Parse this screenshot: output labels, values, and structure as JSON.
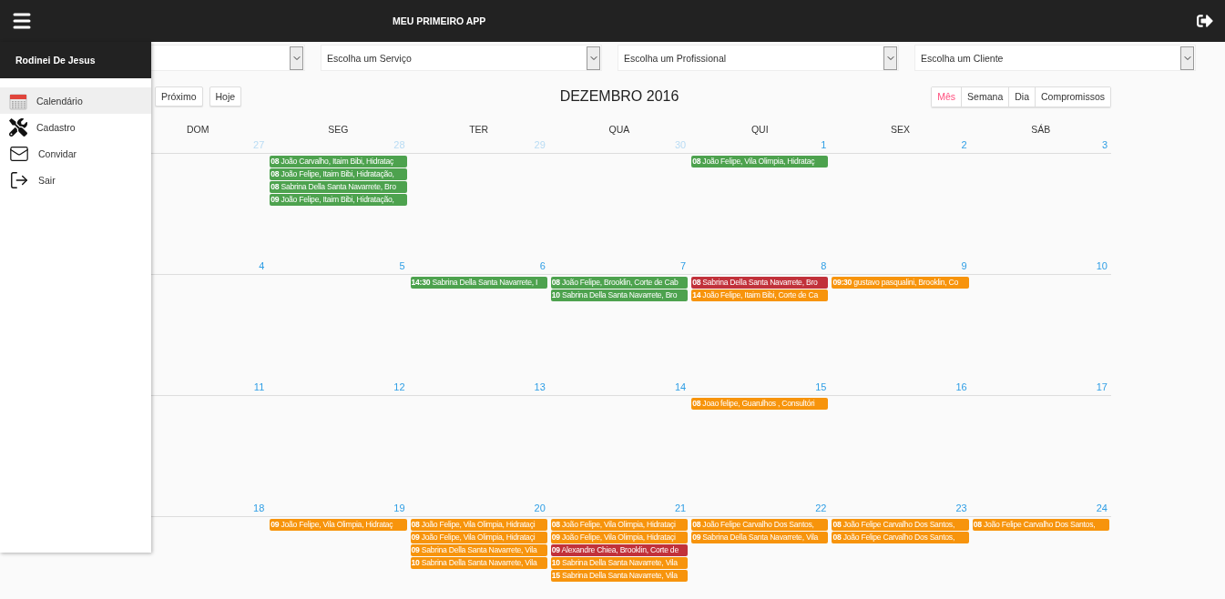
{
  "topbar": {
    "title": "MEU PRIMEIRO APP"
  },
  "drawer": {
    "user": "Rodinei De Jesus",
    "items": [
      {
        "kind": "calendar",
        "label": "Calendário",
        "selected": true
      },
      {
        "kind": "tools",
        "label": "Cadastro",
        "selected": false
      },
      {
        "kind": "mail",
        "label": "Convidar",
        "selected": false
      },
      {
        "kind": "exit",
        "label": "Sair",
        "selected": false
      }
    ]
  },
  "filters": [
    {
      "value": "Escolha um Serviço"
    },
    {
      "value": "Escolha um Profissional"
    },
    {
      "value": "Escolha um Cliente"
    }
  ],
  "nav_buttons": [
    "Próximo",
    "Hoje"
  ],
  "title": "DEZEMBRO 2016",
  "views": [
    {
      "label": "Mês",
      "selected": true
    },
    {
      "label": "Semana",
      "selected": false
    },
    {
      "label": "Dia",
      "selected": false
    },
    {
      "label": "Compromissos",
      "selected": false
    }
  ],
  "weekdays": [
    "DOM",
    "SEG",
    "TER",
    "QUA",
    "QUI",
    "SEX",
    "SÁB"
  ],
  "weeks": [
    {
      "days": [
        {
          "number": "27",
          "other_month": true
        },
        {
          "number": "28",
          "other_month": true,
          "events": [
            {
              "time": "08",
              "text": "João Carvalho, Itaim Bibi, Hidrataç",
              "color": "#4da24e"
            },
            {
              "time": "08",
              "text": "João Felipe, Itaim Bibi, Hidratação,",
              "color": "#4da24e"
            },
            {
              "time": "08",
              "text": "Sabrina Della Santa Navarrete, Bro",
              "color": "#4da24e"
            },
            {
              "time": "09",
              "text": "João Felipe, Itaim Bibi, Hidratação,",
              "color": "#4da24e"
            }
          ]
        },
        {
          "number": "29",
          "other_month": true
        },
        {
          "number": "30",
          "other_month": true
        },
        {
          "number": "1",
          "other_month": false,
          "events": [
            {
              "time": "08",
              "text": "João Felipe, Vila Olimpia, Hidrataç",
              "color": "#4da24e"
            }
          ]
        },
        {
          "number": "2",
          "other_month": false
        },
        {
          "number": "3",
          "other_month": false
        }
      ]
    },
    {
      "days": [
        {
          "number": "4",
          "other_month": false
        },
        {
          "number": "5",
          "other_month": false
        },
        {
          "number": "6",
          "other_month": false,
          "events": [
            {
              "time": "14:30",
              "text": "Sabrina Della Santa Navarrete, I",
              "color": "#4da24e"
            }
          ]
        },
        {
          "number": "7",
          "other_month": false,
          "events": [
            {
              "time": "08",
              "text": "João Felipe, Brooklin, Corte de Cab",
              "color": "#4da24e"
            },
            {
              "time": "10",
              "text": "Sabrina Della Santa Navarrete, Bro",
              "color": "#4da24e"
            }
          ]
        },
        {
          "number": "8",
          "other_month": false,
          "events": [
            {
              "time": "08",
              "text": "Sabrina Della Santa Navarrete, Bro",
              "color": "#c1313a"
            },
            {
              "time": "14",
              "text": "João Felipe, Itaim Bibi, Corte de Ca",
              "color": "#f7940c"
            }
          ]
        },
        {
          "number": "9",
          "other_month": false,
          "events": [
            {
              "time": "09:30",
              "text": "gustavo pasqualini, Brooklin, Co",
              "color": "#f7940c"
            }
          ]
        },
        {
          "number": "10",
          "other_month": false
        }
      ]
    },
    {
      "days": [
        {
          "number": "11",
          "other_month": false
        },
        {
          "number": "12",
          "other_month": false
        },
        {
          "number": "13",
          "other_month": false
        },
        {
          "number": "14",
          "other_month": false
        },
        {
          "number": "15",
          "other_month": false,
          "events": [
            {
              "time": "08",
              "text": "Joao felipe, Guarulhos , Consultóri",
              "color": "#f7940c"
            }
          ]
        },
        {
          "number": "16",
          "other_month": false
        },
        {
          "number": "17",
          "other_month": false
        }
      ]
    },
    {
      "days": [
        {
          "number": "18",
          "other_month": false
        },
        {
          "number": "19",
          "other_month": false,
          "events": [
            {
              "time": "09",
              "text": "João Felipe, Vila Olimpia, Hidrataç",
              "color": "#f7940c"
            }
          ]
        },
        {
          "number": "20",
          "other_month": false,
          "events": [
            {
              "time": "08",
              "text": "João Felipe, Vila Olimpia, Hidrataçi",
              "color": "#f7940c"
            },
            {
              "time": "09",
              "text": "João Felipe, Vila Olimpia, Hidrataçi",
              "color": "#f7940c"
            },
            {
              "time": "09",
              "text": "Sabrina Della Santa Navarrete, Vila",
              "color": "#f7940c"
            },
            {
              "time": "10",
              "text": "Sabrina Della Santa Navarrete, Vila",
              "color": "#f7940c"
            }
          ]
        },
        {
          "number": "21",
          "other_month": false,
          "events": [
            {
              "time": "08",
              "text": "João Felipe, Vila Olimpia, Hidrataçi",
              "color": "#f7940c"
            },
            {
              "time": "09",
              "text": "João Felipe, Vila Olimpia, Hidrataçi",
              "color": "#f7940c"
            },
            {
              "time": "09",
              "text": "Alexandre Chiea, Brooklin, Corte de",
              "color": "#c1313a"
            },
            {
              "time": "10",
              "text": "Sabrina Della Santa Navarrete, Vila",
              "color": "#f7940c"
            },
            {
              "time": "15",
              "text": "Sabrina Della Santa Navarrete, Vila",
              "color": "#f7940c"
            }
          ]
        },
        {
          "number": "22",
          "other_month": false,
          "events": [
            {
              "time": "08",
              "text": "João Felipe Carvalho Dos Santos,",
              "color": "#f7940c"
            },
            {
              "time": "09",
              "text": "Sabrina Della Santa Navarrete, Vila",
              "color": "#f7940c"
            }
          ]
        },
        {
          "number": "23",
          "other_month": false,
          "events": [
            {
              "time": "08",
              "text": "João Felipe Carvalho Dos Santos,",
              "color": "#f7940c"
            },
            {
              "time": "08",
              "text": "João Felipe Carvalho Dos Santos,",
              "color": "#f7940c"
            }
          ]
        },
        {
          "number": "24",
          "other_month": false,
          "events": [
            {
              "time": "08",
              "text": "João Felipe Carvalho Dos Santos,",
              "color": "#f7940c"
            }
          ]
        }
      ]
    }
  ]
}
